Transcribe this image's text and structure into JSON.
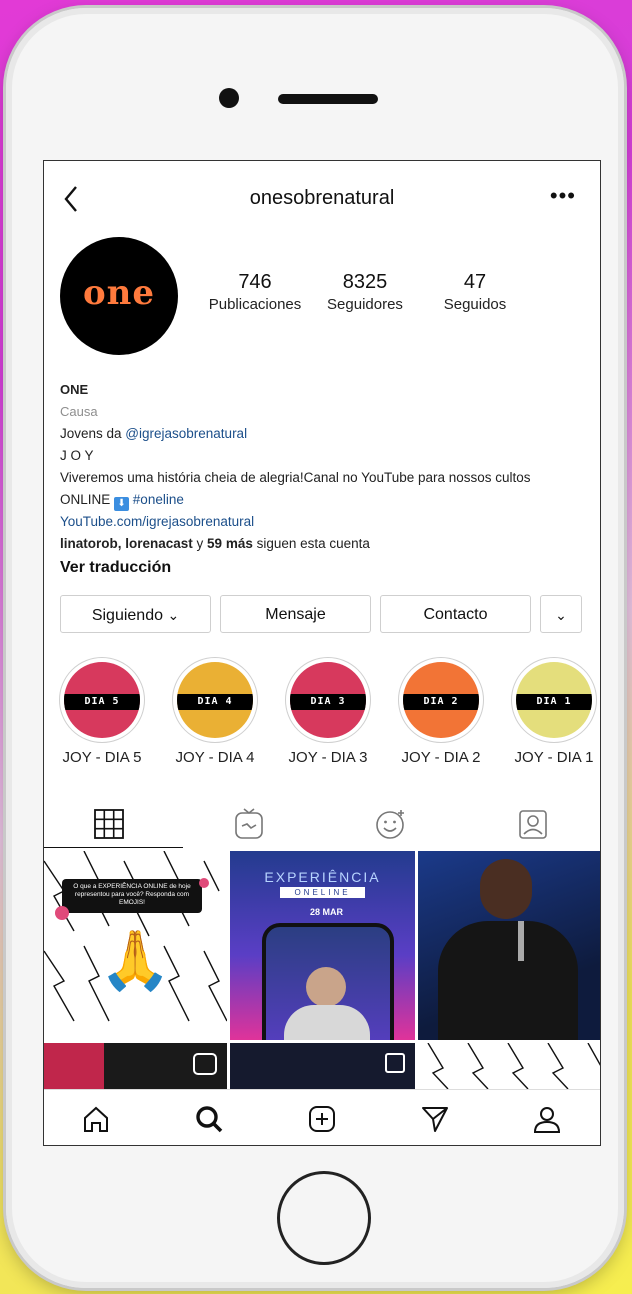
{
  "header": {
    "username": "onesobrenatural",
    "more": "•••"
  },
  "avatar": {
    "text": "one"
  },
  "stats": [
    {
      "value": "746",
      "label": "Publicaciones"
    },
    {
      "value": "8325",
      "label": "Seguidores"
    },
    {
      "value": "47",
      "label": "Seguidos"
    }
  ],
  "bio": {
    "name": "ONE",
    "category": "Causa",
    "line1_prefix": "Jovens da ",
    "line1_mention": "@igrejasobrenatural",
    "line2": "J O Y",
    "line3": "Viveremos uma história cheia de alegria!Canal no YouTube para nossos cultos",
    "line4_prefix": "ONLINE",
    "line4_tag": "#oneline",
    "website": "YouTube.com/igrejasobrenatural",
    "followed_names": "linatorob, lorenacast",
    "followed_mid": " y ",
    "followed_count": "59 más",
    "followed_suffix": " siguen esta cuenta",
    "translate": "Ver traducción"
  },
  "buttons": {
    "following": "Siguiendo",
    "following_chevron": "⌄",
    "message": "Mensaje",
    "contact": "Contacto",
    "dropdown": "⌄"
  },
  "highlights": [
    {
      "label": "JOY - DIA 5",
      "band": "DIA 5",
      "color": "#d7395d"
    },
    {
      "label": "JOY - DIA 4",
      "band": "DIA 4",
      "color": "#eab034"
    },
    {
      "label": "JOY - DIA 3",
      "band": "DIA 3",
      "color": "#d7395d"
    },
    {
      "label": "JOY - DIA 2",
      "band": "DIA 2",
      "color": "#f27436"
    },
    {
      "label": "JOY - DIA 1",
      "band": "DIA 1",
      "color": "#e4de7c"
    }
  ],
  "posts": {
    "post1_text": "O que a EXPERIÊNCIA ONLINE de hoje representou para você? Responda com EMOJIS!",
    "post2_title": "EXPERIÊNCIA",
    "post2_sub": "ONELINE",
    "post2_date": "28 MAR"
  },
  "colors": {
    "accent_link": "#1c4f8a",
    "bio_grey": "#8e8e8e"
  }
}
